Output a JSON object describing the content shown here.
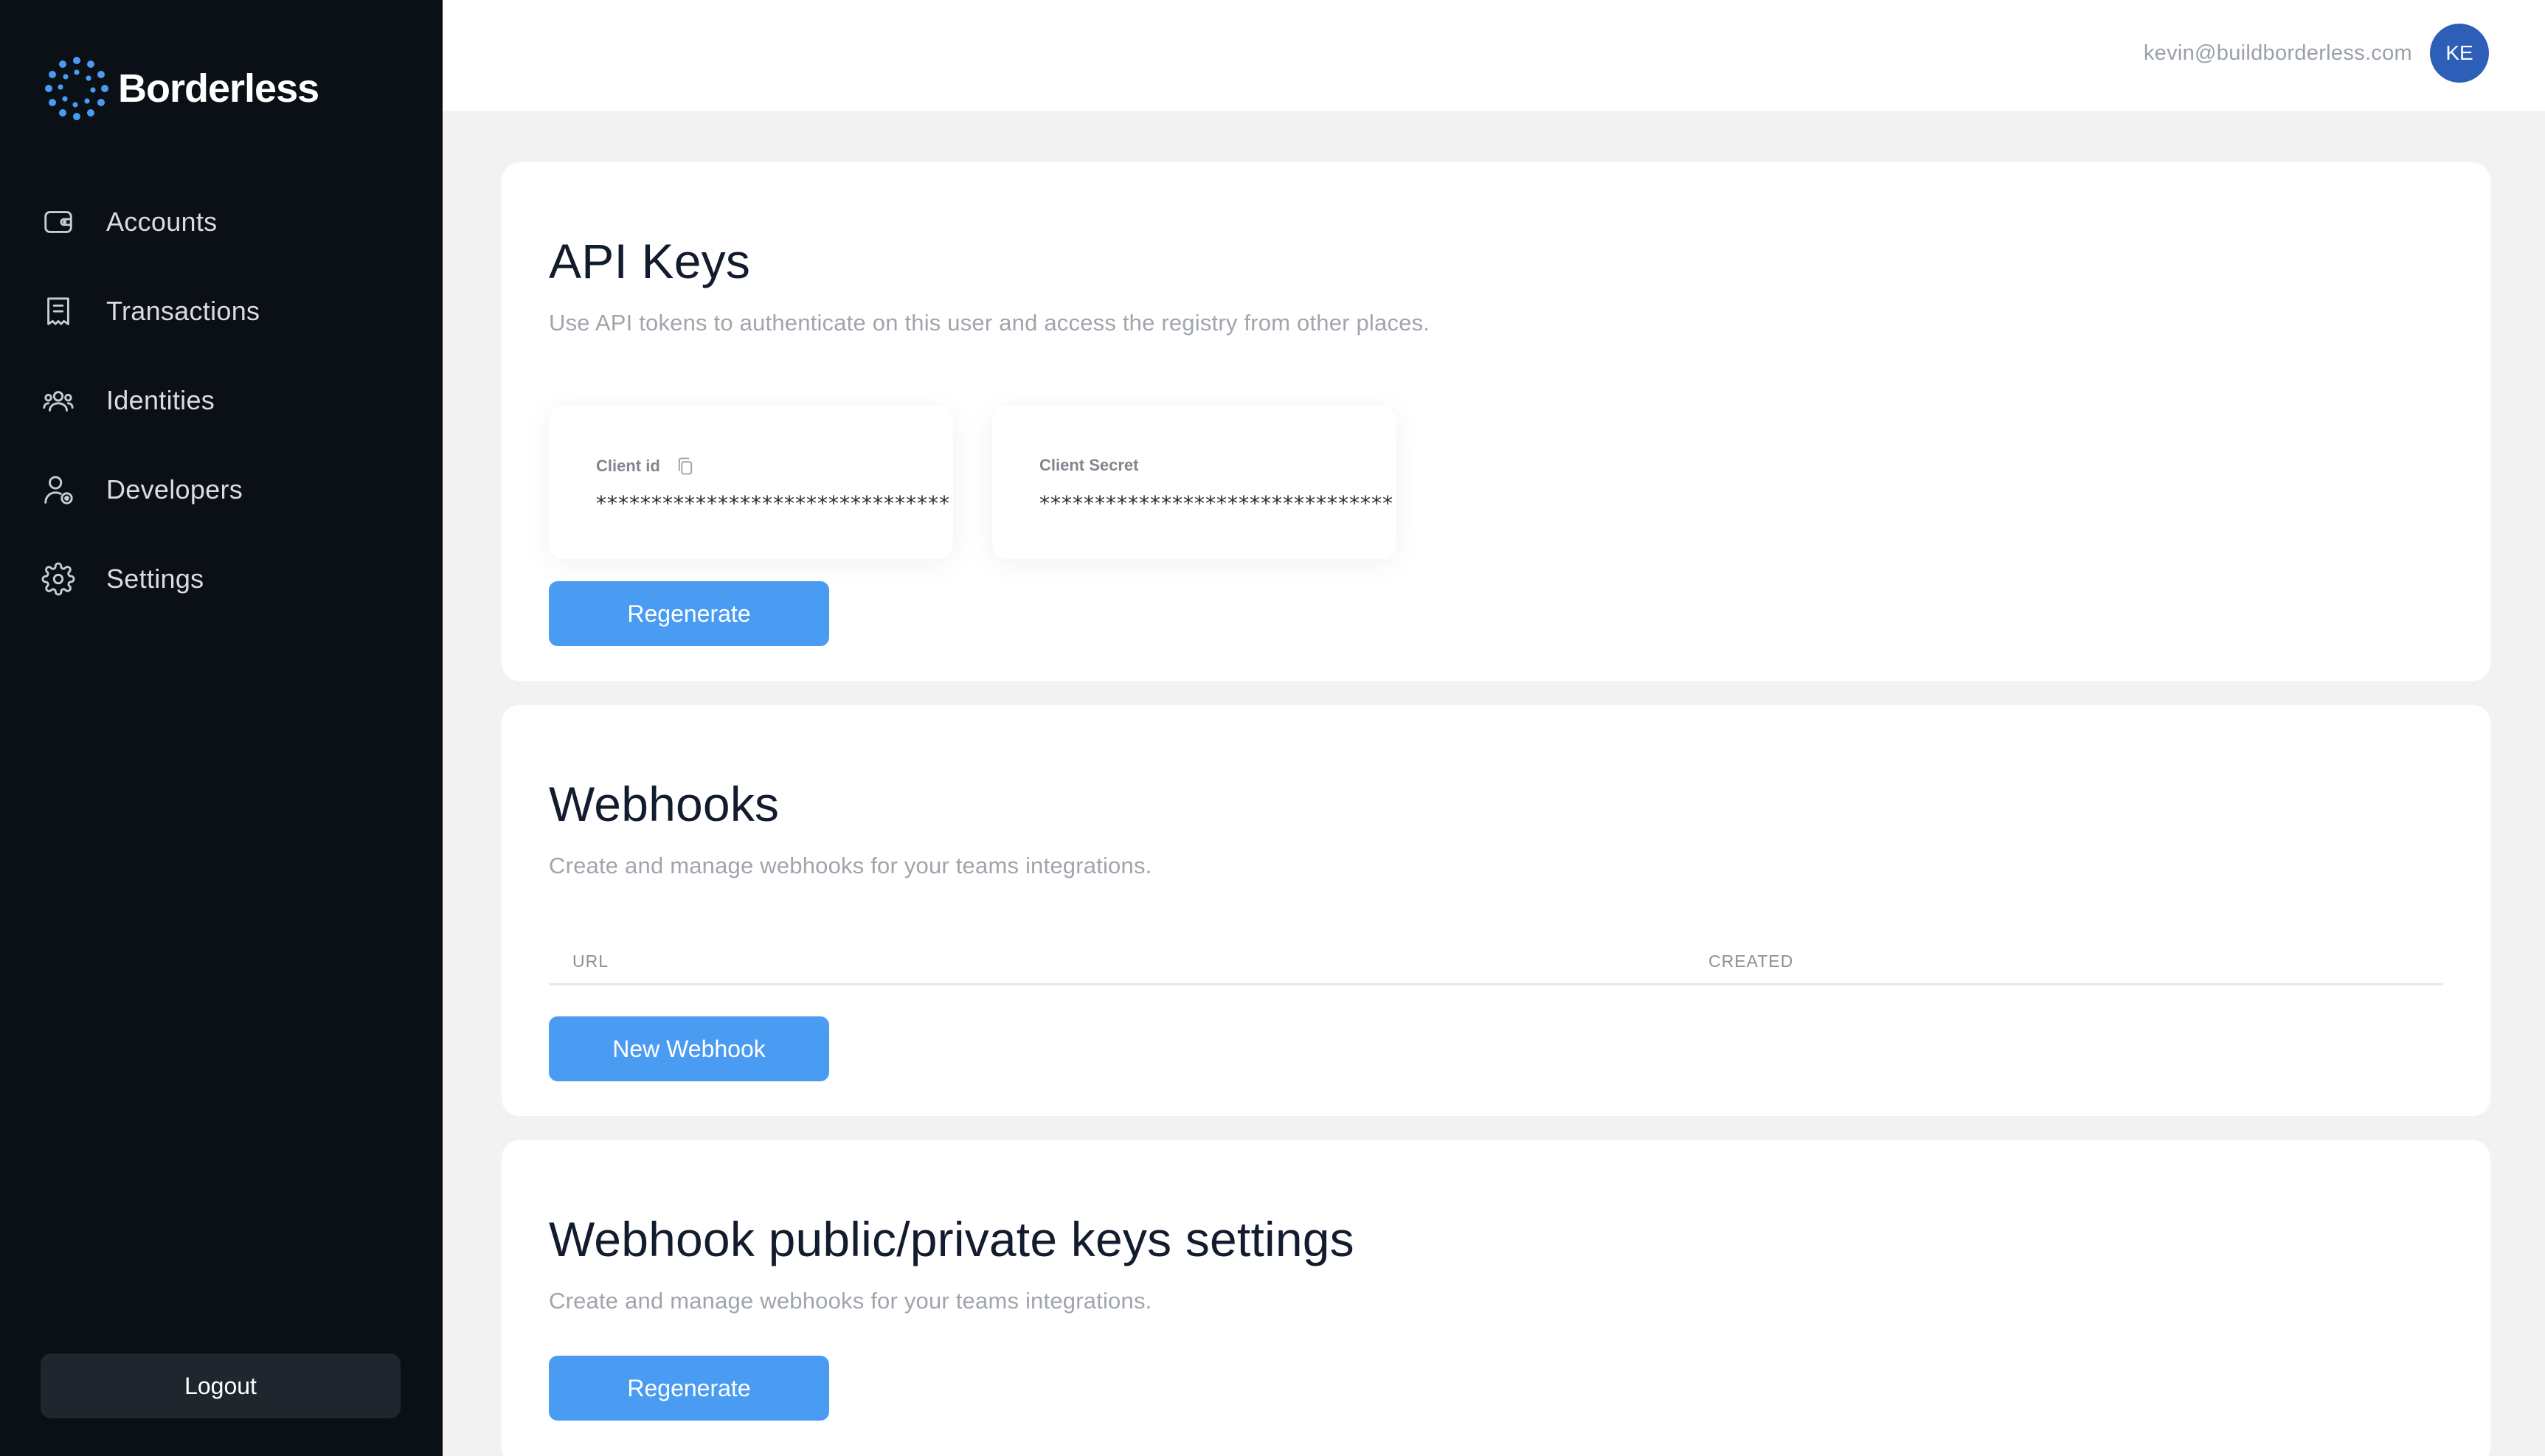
{
  "app": {
    "name": "Borderless"
  },
  "sidebar": {
    "items": [
      {
        "label": "Accounts",
        "icon": "wallet-icon"
      },
      {
        "label": "Transactions",
        "icon": "receipt-icon"
      },
      {
        "label": "Identities",
        "icon": "users-icon"
      },
      {
        "label": "Developers",
        "icon": "developer-user-icon"
      },
      {
        "label": "Settings",
        "icon": "gear-icon"
      }
    ],
    "logout_label": "Logout"
  },
  "header": {
    "user_email": "kevin@buildborderless.com",
    "avatar_initials": "KE"
  },
  "api_keys": {
    "title": "API Keys",
    "description": "Use API tokens to authenticate on this user and access the registry from other places.",
    "client_id_label": "Client id",
    "client_id_value": "********************************",
    "client_secret_label": "Client Secret",
    "client_secret_value": "********************************",
    "regenerate_label": "Regenerate"
  },
  "webhooks": {
    "title": "Webhooks",
    "description": "Create and manage webhooks for your teams integrations.",
    "columns": [
      "URL",
      "CREATED"
    ],
    "new_label": "New Webhook"
  },
  "webhook_keys": {
    "title": "Webhook public/private keys settings",
    "description": "Create and manage webhooks for your teams integrations.",
    "regenerate_label": "Regenerate"
  },
  "colors": {
    "sidebar_bg": "#0b1016",
    "accent": "#4a9bf2",
    "avatar_bg": "#2d5fb8",
    "page_bg": "#f2f2f3"
  }
}
